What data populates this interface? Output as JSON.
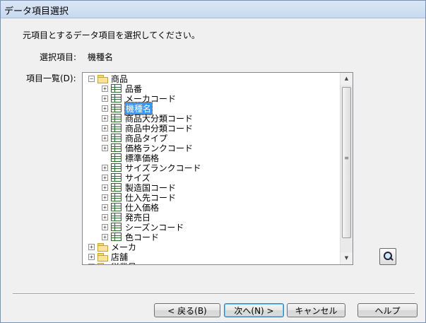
{
  "window": {
    "title": "データ項目選択"
  },
  "instruction": "元項目とするデータ項目を選択してください。",
  "selection": {
    "label": "選択項目:",
    "value": "機種名"
  },
  "item_list_label": "項目一覧(D):",
  "tree": {
    "root": {
      "label": "商品",
      "expander": "−"
    },
    "children": [
      {
        "label": "品番",
        "expander": "+"
      },
      {
        "label": "メーカコード",
        "expander": "+"
      },
      {
        "label": "機種名",
        "expander": "+",
        "selected": true
      },
      {
        "label": "商品大分類コード",
        "expander": "+"
      },
      {
        "label": "商品中分類コード",
        "expander": "+"
      },
      {
        "label": "商品タイプ",
        "expander": "+"
      },
      {
        "label": "価格ランクコード",
        "expander": "+"
      },
      {
        "label": "標準価格",
        "expander": ""
      },
      {
        "label": "サイズランクコード",
        "expander": "+"
      },
      {
        "label": "サイズ",
        "expander": "+"
      },
      {
        "label": "製造国コード",
        "expander": "+"
      },
      {
        "label": "仕入先コード",
        "expander": "+"
      },
      {
        "label": "仕入価格",
        "expander": "+"
      },
      {
        "label": "発売日",
        "expander": "+"
      },
      {
        "label": "シーズンコード",
        "expander": "+"
      },
      {
        "label": "色コード",
        "expander": "+"
      }
    ],
    "siblings": [
      {
        "label": "メーカ",
        "expander": "+"
      },
      {
        "label": "店舗",
        "expander": "+"
      },
      {
        "label": "従業員",
        "expander": "+"
      }
    ]
  },
  "icons": {
    "search": "magnifier-icon",
    "folder": "folder-icon",
    "table": "table-icon"
  },
  "buttons": {
    "back": "< 戻る(B)",
    "next": "次へ(N) >",
    "cancel": "キャンセル",
    "help": "ヘルプ"
  }
}
